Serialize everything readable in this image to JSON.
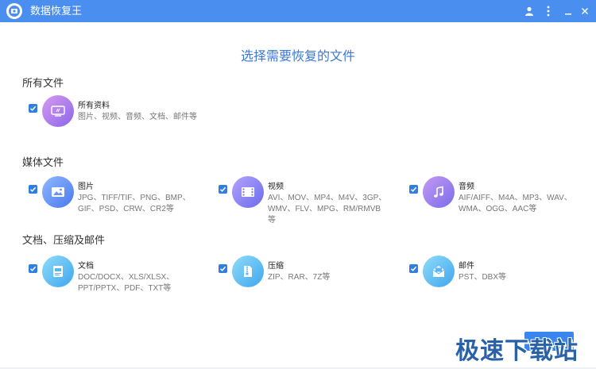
{
  "window": {
    "title": "数据恢复王",
    "icons": {
      "logo": "app-logo-icon",
      "user": "user-icon",
      "menu": "more-vertical-icon",
      "minimize": "minimize-icon",
      "close": "close-icon"
    },
    "colors": {
      "titlebar": "#4a8ff0",
      "accent": "#3c78d8",
      "checkbox": "#2f7fe0"
    }
  },
  "main": {
    "heading": "选择需要恢复的文件",
    "sections": [
      {
        "title": "所有文件",
        "items": [
          {
            "name": "所有资料",
            "desc": "图片、视频、音频、文档、邮件等",
            "checked": true,
            "icon": "all-data-icon"
          }
        ]
      },
      {
        "title": "媒体文件",
        "items": [
          {
            "name": "图片",
            "desc": "JPG、TIFF/TIF、PNG、BMP、GIF、PSD、CRW、CR2等",
            "checked": true,
            "icon": "image-icon"
          },
          {
            "name": "视频",
            "desc": "AVI、MOV、MP4、M4V、3GP、WMV、FLV、MPG、RM/RMVB等",
            "checked": true,
            "icon": "video-icon"
          },
          {
            "name": "音频",
            "desc": "AIF/AIFF、M4A、MP3、WAV、WMA、OGG、AAC等",
            "checked": true,
            "icon": "music-icon"
          }
        ]
      },
      {
        "title": "文档、压缩及邮件",
        "items": [
          {
            "name": "文档",
            "desc": "DOC/DOCX、XLS/XLSX、PPT/PPTX、PDF、TXT等",
            "checked": true,
            "icon": "document-icon"
          },
          {
            "name": "压缩",
            "desc": "ZIP、RAR、7Z等",
            "checked": true,
            "icon": "archive-icon"
          },
          {
            "name": "邮件",
            "desc": "PST、DBX等",
            "checked": true,
            "icon": "mail-icon"
          }
        ]
      }
    ]
  },
  "footer": {
    "watermark": "极速下载站"
  }
}
